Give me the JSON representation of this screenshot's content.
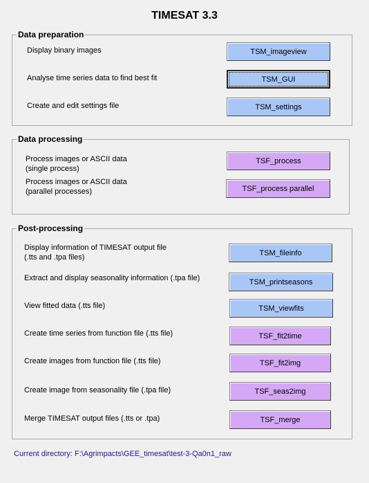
{
  "title": "TIMESAT 3.3",
  "data_preparation": {
    "label": "Data preparation",
    "rows": [
      {
        "desc": "Display binary images",
        "button": "TSM_imageview"
      },
      {
        "desc": "Analyse time series data to find best fit",
        "button": "TSM_GUI"
      },
      {
        "desc": "Create and edit settings file",
        "button": "TSM_settings"
      }
    ]
  },
  "data_processing": {
    "label": "Data processing",
    "rows": [
      {
        "desc_line1": "Process images or ASCII data",
        "desc_line2": "(single process)",
        "button": "TSF_process"
      },
      {
        "desc_line1": "Process images or ASCII data",
        "desc_line2": "(parallel processes)",
        "button": "TSF_process parallel"
      }
    ]
  },
  "post_processing": {
    "label": "Post-processing",
    "rows": [
      {
        "desc_line1": "Display information of TIMESAT output file",
        "desc_line2": "(.tts and .tpa files)",
        "button": "TSM_fileinfo"
      },
      {
        "desc": "Extract and display seasonality information (.tpa file)",
        "button": "TSM_printseasons"
      },
      {
        "desc": "View fitted data (.tts file)",
        "button": "TSM_viewfits"
      },
      {
        "desc": "Create time series from function file (.tts file)",
        "button": "TSF_fit2time"
      },
      {
        "desc": "Create images from function file (.tts file)",
        "button": "TSF_fit2img"
      },
      {
        "desc": "Create image from seasonality file (.tpa file)",
        "button": "TSF_seas2img"
      },
      {
        "desc": "Merge TIMESAT output files (.tts or .tpa)",
        "button": "TSF_merge"
      }
    ]
  },
  "footer": {
    "current_directory": "Current directory:  F:\\Agrimpacts\\GEE_timesat\\test-3-Qa0n1_raw"
  },
  "colors": {
    "tsm_button": "#a8c6f6",
    "tsf_button": "#d4a8f4",
    "footer_text": "#1a1aa0"
  }
}
